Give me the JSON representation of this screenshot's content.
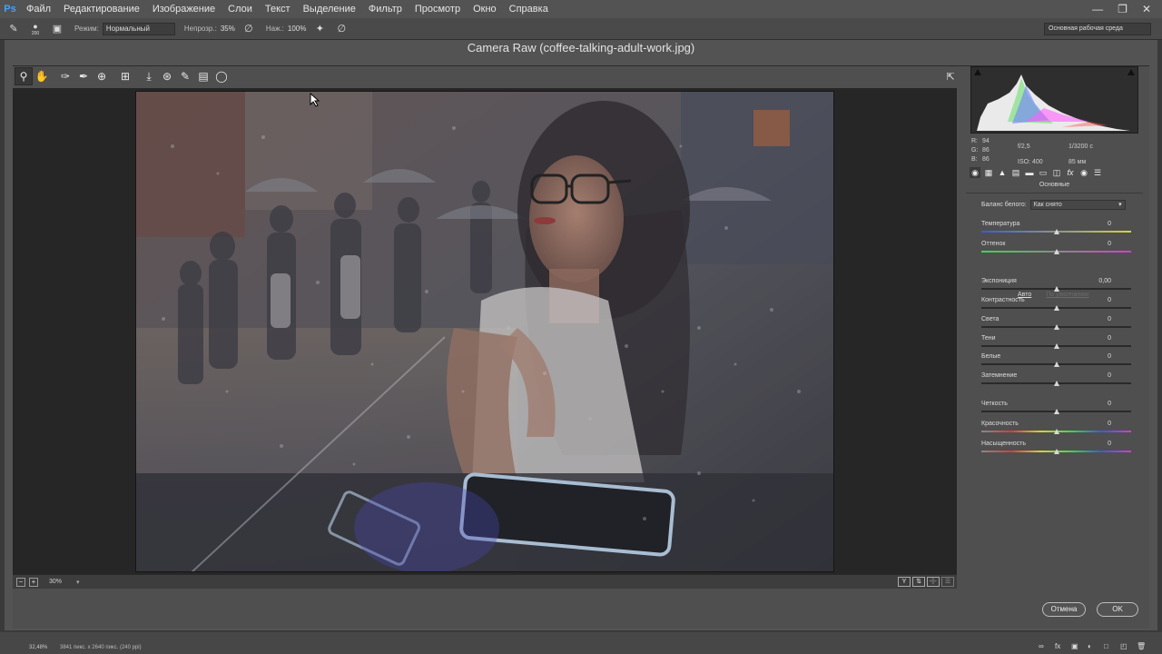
{
  "menubar": {
    "logo": "Ps",
    "items": [
      "Файл",
      "Редактирование",
      "Изображение",
      "Слои",
      "Текст",
      "Выделение",
      "Фильтр",
      "Просмотр",
      "Окно",
      "Справка"
    ]
  },
  "options_bar": {
    "brush_size": "200",
    "mode_label": "Режим:",
    "mode_value": "Нормальный",
    "opacity_label": "Непрозр.:",
    "opacity_value": "35%",
    "flow_label": "Наж.:",
    "flow_value": "100%",
    "workspace": "Основная рабочая среда"
  },
  "dialog": {
    "title": "Camera Raw (coffee-talking-adult-work.jpg)",
    "zoom": "30%",
    "cancel_label": "Отмена",
    "ok_label": "OK"
  },
  "readout": {
    "r_label": "R:",
    "r": "94",
    "g_label": "G:",
    "g": "86",
    "b_label": "B:",
    "b": "86",
    "aperture": "f/2,5",
    "shutter": "1/3200 с",
    "iso": "ISO: 400",
    "focal": "85 мм"
  },
  "panel": {
    "title": "Основные",
    "wb_label": "Баланс белого:",
    "wb_value": "Как снято",
    "auto_label": "Авто",
    "default_label": "По умолчанию",
    "sliders": [
      {
        "name": "Температура",
        "value": "0",
        "pos": 0.5,
        "gradient": "temp"
      },
      {
        "name": "Оттенок",
        "value": "0",
        "pos": 0.5,
        "gradient": "tint"
      },
      {
        "name": "Экспониция",
        "value": "0,00",
        "pos": 0.5,
        "gradient": "none"
      },
      {
        "name": "Контрастность",
        "value": "0",
        "pos": 0.5,
        "gradient": "none"
      },
      {
        "name": "Света",
        "value": "0",
        "pos": 0.5,
        "gradient": "none"
      },
      {
        "name": "Тени",
        "value": "0",
        "pos": 0.5,
        "gradient": "none"
      },
      {
        "name": "Белые",
        "value": "0",
        "pos": 0.5,
        "gradient": "none"
      },
      {
        "name": "Затемнение",
        "value": "0",
        "pos": 0.5,
        "gradient": "none"
      },
      {
        "name": "Четкость",
        "value": "0",
        "pos": 0.5,
        "gradient": "none"
      },
      {
        "name": "Красочность",
        "value": "0",
        "pos": 0.5,
        "gradient": "sat"
      },
      {
        "name": "Насыщенность",
        "value": "0",
        "pos": 0.5,
        "gradient": "sat"
      }
    ]
  },
  "statusbar": {
    "zoom": "32,48%",
    "doc_info": "3841 пикс. x 2640 пикс. (240 ppi)"
  },
  "colors": {
    "accent": "#3fa3ff",
    "panel_bg": "#535353",
    "preview_bg": "#262626"
  }
}
